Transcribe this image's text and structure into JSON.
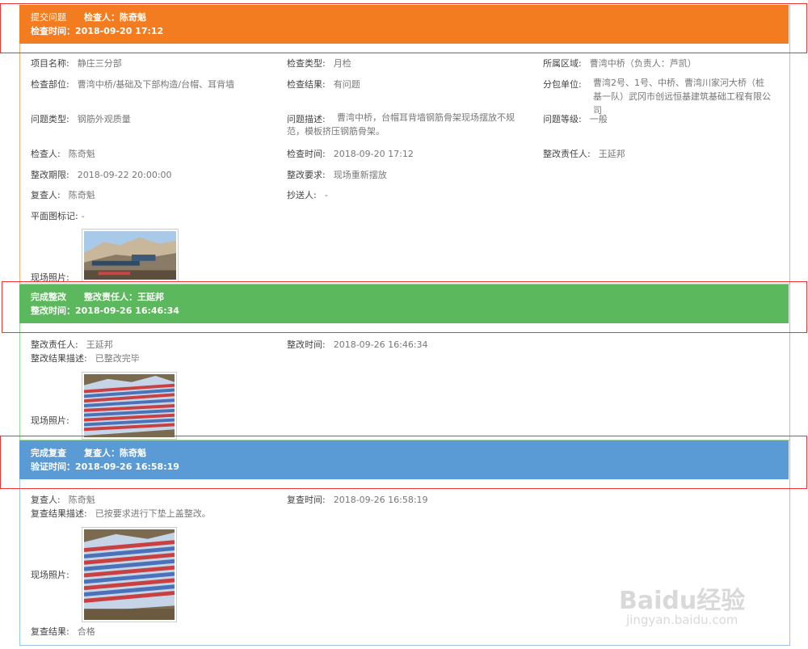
{
  "section1": {
    "header": {
      "title": "提交问题",
      "inspector_label": "检查人：",
      "inspector": "陈奇魁",
      "time_label": "检查时间：",
      "time": "2018-09-20 17:12"
    },
    "fields": {
      "project_label": "项目名称:",
      "project": "静庄三分部",
      "check_type_label": "检查类型:",
      "check_type": "月检",
      "area_label": "所属区域:",
      "area": "曹湾中桥（负责人：芦凯）",
      "part_label": "检查部位:",
      "part": "曹湾中桥/基础及下部构造/台帽、耳背墙",
      "result_label": "检查结果:",
      "result": "有问题",
      "subcontract_label": "分包单位:",
      "subcontract": "曹湾2号、1号、中桥、曹湾川家河大桥（桩基一队）武冈市创远恒基建筑基础工程有限公司",
      "issue_type_label": "问题类型:",
      "issue_type": "钢筋外观质量",
      "issue_desc_label": "问题描述:",
      "issue_desc": "曹湾中桥，台帽耳背墙钢筋骨架现场摆放不规范，模板挤压钢筋骨架。",
      "issue_level_label": "问题等级:",
      "issue_level": "一般",
      "inspector_label": "检查人:",
      "inspector": "陈奇魁",
      "check_time_label": "检查时间:",
      "check_time": "2018-09-20 17:12",
      "rectify_person_label": "整改责任人:",
      "rectify_person": "王延邦",
      "deadline_label": "整改期限:",
      "deadline": "2018-09-22 20:00:00",
      "requirement_label": "整改要求:",
      "requirement": "现场重新摆放",
      "reviewer_label": "复查人:",
      "reviewer": "陈奇魁",
      "cc_label": "抄送人:",
      "cc": "-",
      "plan_mark_label": "平面图标记:",
      "plan_mark": "-",
      "photo_label": "现场照片:"
    }
  },
  "section2": {
    "header": {
      "title": "完成整改",
      "person_label": "整改责任人：",
      "person": "王延邦",
      "time_label": "整改时间：",
      "time": "2018-09-26 16:46:34"
    },
    "fields": {
      "person_label": "整改责任人:",
      "person": "王延邦",
      "time_label": "整改时间:",
      "time": "2018-09-26 16:46:34",
      "desc_label": "整改结果描述:",
      "desc": "已整改完毕",
      "photo_label": "现场照片:"
    }
  },
  "section3": {
    "header": {
      "title": "完成复查",
      "reviewer_label": "复查人：",
      "reviewer": "陈奇魁",
      "time_label": "验证时间：",
      "time": "2018-09-26 16:58:19"
    },
    "fields": {
      "reviewer_label": "复查人:",
      "reviewer": "陈奇魁",
      "time_label": "复查时间:",
      "time": "2018-09-26 16:58:19",
      "desc_label": "复查结果描述:",
      "desc": "已按要求进行下垫上盖整改。",
      "photo_label": "现场照片:",
      "result_label": "复查结果:",
      "result": "合格"
    }
  },
  "watermark": {
    "brand": "Baidu经验",
    "url": "jingyan.baidu.com"
  },
  "colors": {
    "orange": "#f47c20",
    "green": "#5cb85c",
    "blue": "#5b9bd5",
    "highlight": "#e33333"
  }
}
